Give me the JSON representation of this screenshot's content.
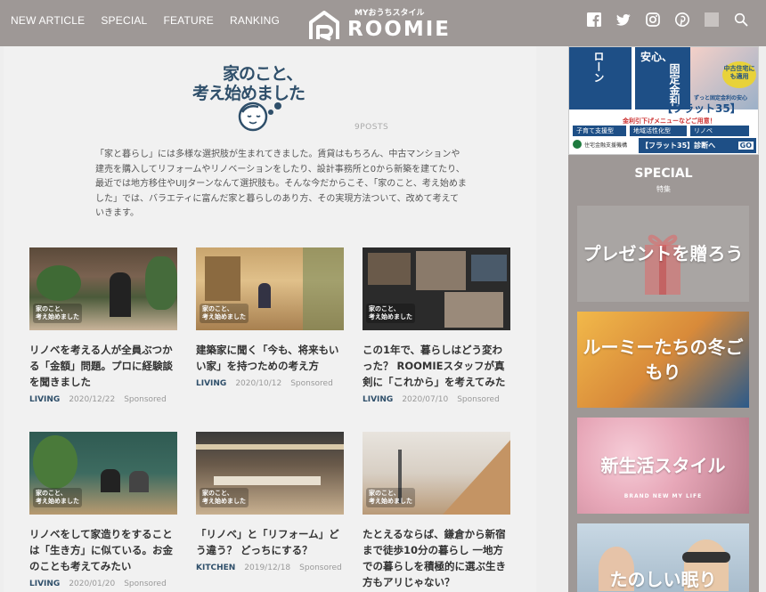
{
  "header": {
    "nav": [
      "NEW ARTICLE",
      "SPECIAL",
      "FEATURE",
      "RANKING"
    ],
    "logo_sub": "MYおうちスタイル",
    "logo_text": "ROOMIE",
    "social_icons": [
      "facebook-icon",
      "twitter-icon",
      "instagram-icon",
      "pinterest-icon",
      "search-icon"
    ]
  },
  "feature": {
    "logo_line1": "家のこと、",
    "logo_line2": "考え始めました",
    "posts": "9POSTS",
    "intro": "「家と暮らし」には多様な選択肢が生まれてきました。賃貸はもちろん、中古マンションや建売を購入してリフォームやリノベーションをしたり、設計事務所と0から新築を建てたり、最近では地方移住やUIJターンなんて選択肢も。そんな今だからこそ、「家のこと、考え始めました」では、バラエティに富んだ家と暮らしのあり方、その実現方法ついて、改めて考えていきます。"
  },
  "thumb_badge": "家のこと、\n考え始めました",
  "articles": [
    {
      "title": "リノベを考える人が全員ぶつかる「金額」問題。プロに経験談を聞きました",
      "category": "LIVING",
      "date": "2020/12/22",
      "sponsor": "Sponsored"
    },
    {
      "title": "建築家に聞く「今も、将来もいい家」を持つための考え方",
      "category": "LIVING",
      "date": "2020/10/12",
      "sponsor": "Sponsored"
    },
    {
      "title": "この1年で、暮らしはどう変わった？ ROOMIEスタッフが真剣に「これから」を考えてみた",
      "category": "LIVING",
      "date": "2020/07/10",
      "sponsor": "Sponsored"
    },
    {
      "title": "リノベをして家造りをすることは「生き方」に似ている。お金のことも考えてみたい",
      "category": "LIVING",
      "date": "2020/01/20",
      "sponsor": "Sponsored"
    },
    {
      "title": "「リノベ」と「リフォーム」どう違う？ どっちにする？",
      "category": "KITCHEN",
      "date": "2019/12/18",
      "sponsor": "Sponsored"
    },
    {
      "title": "たとえるならば、鎌倉から新宿まで徒歩10分の暮らし 一地方での暮らしを積極的に選ぶ生き方もアリじゃない？",
      "category": "",
      "date": "",
      "sponsor": ""
    }
  ],
  "ad": {
    "line1": "安心、",
    "line2": "固定金利",
    "line3": "ローン",
    "badge": "中古住宅にも適用",
    "brand": "【フラット35】",
    "tagline": "ずっと固定金利の安心",
    "menu_note": "金利引下げメニューなどご用意！",
    "tags": [
      "子育て支援型",
      "地域活性化型",
      "リノベ"
    ],
    "org": "住宅金融支援機構",
    "cta": "【フラット35】診断へ",
    "go": "GO"
  },
  "special": {
    "heading": "SPECIAL",
    "sub": "特集",
    "banners": [
      "プレゼントを贈ろう",
      "ルーミーたちの冬ごもり",
      "新生活スタイル",
      "たのしい眠り"
    ],
    "banner3_small": "BRAND NEW MY LIFE"
  },
  "colors": {
    "header": "#9e9896",
    "accent": "#2f4f6a",
    "ad_green": "#1e7a3e"
  }
}
